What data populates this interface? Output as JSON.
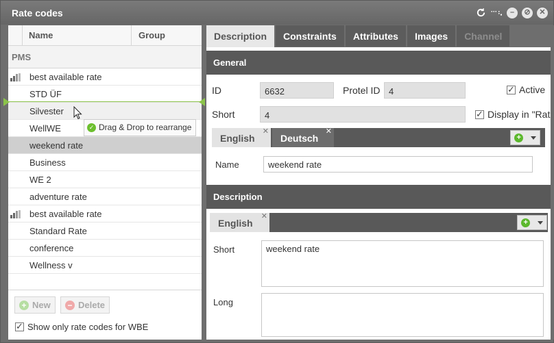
{
  "window": {
    "title": "Rate codes"
  },
  "left": {
    "col_name": "Name",
    "col_group": "Group",
    "group": "PMS",
    "rows": [
      {
        "name": "best available rate",
        "icon": true
      },
      {
        "name": "STD ÜF"
      },
      {
        "name": "Silvester"
      },
      {
        "name": "WellWE"
      },
      {
        "name": "weekend rate"
      },
      {
        "name": "Business"
      },
      {
        "name": "WE 2"
      },
      {
        "name": "adventure rate"
      },
      {
        "name": "best available rate",
        "icon": true
      },
      {
        "name": "Standard Rate"
      },
      {
        "name": "conference"
      },
      {
        "name": "Wellness v"
      }
    ],
    "tooltip": "Drag & Drop to rearrange",
    "new_label": "New",
    "delete_label": "Delete",
    "wbe_label": "Show only rate codes for WBE"
  },
  "right": {
    "tabs": [
      "Description",
      "Constraints",
      "Attributes",
      "Images",
      "Channel"
    ],
    "general_title": "General",
    "id_label": "ID",
    "id_value": "6632",
    "protel_label": "Protel ID",
    "protel_value": "4",
    "active_label": "Active",
    "short_label": "Short",
    "short_value": "4",
    "display_label": "Display in \"Rat",
    "lang_tabs": [
      "English",
      "Deutsch"
    ],
    "name_label": "Name",
    "name_value": "weekend rate",
    "desc_title": "Description",
    "desc_lang": "English",
    "desc_short_label": "Short",
    "desc_short_value": "weekend rate",
    "desc_long_label": "Long"
  },
  "colors": {
    "accent_green": "#8bc34a",
    "header_gray": "#595959"
  }
}
